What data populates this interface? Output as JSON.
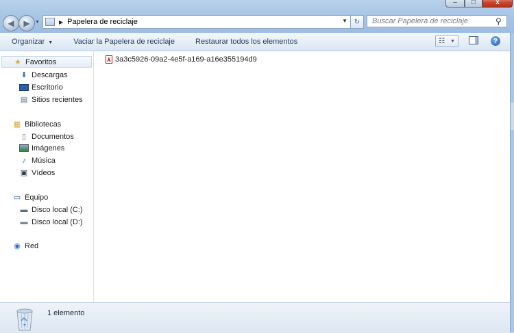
{
  "window": {
    "controls": {
      "minimize": "–",
      "maximize": "□",
      "close": "x"
    }
  },
  "address": {
    "location": "Papelera de reciclaje",
    "search_placeholder": "Buscar Papelera de reciclaje"
  },
  "toolbar": {
    "organize": "Organizar",
    "empty_bin": "Vaciar la Papelera de reciclaje",
    "restore_all": "Restaurar todos los elementos"
  },
  "navigation": {
    "favorites": {
      "label": "Favoritos",
      "items": [
        "Descargas",
        "Escritorio",
        "Sitios recientes"
      ]
    },
    "libraries": {
      "label": "Bibliotecas",
      "items": [
        "Documentos",
        "Imágenes",
        "Música",
        "Vídeos"
      ]
    },
    "computer": {
      "label": "Equipo",
      "items": [
        "Disco local (C:)",
        "Disco local (D:)"
      ]
    },
    "network": {
      "label": "Red"
    }
  },
  "files": [
    {
      "name": "3a3c5926-09a2-4e5f-a169-a16e355194d9",
      "icon": "pdf-icon"
    }
  ],
  "status": {
    "count": "1 elemento"
  },
  "colors": {
    "frame": "#a9c6e6",
    "toolbar_text": "#1e395b",
    "close_red": "#c9452c"
  }
}
